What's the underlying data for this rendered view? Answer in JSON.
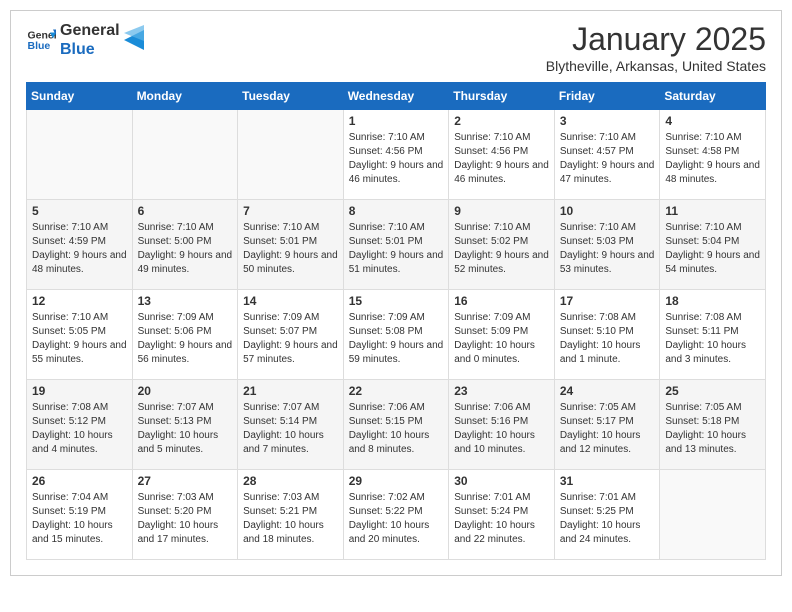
{
  "header": {
    "logo_line1": "General",
    "logo_line2": "Blue",
    "month": "January 2025",
    "location": "Blytheville, Arkansas, United States"
  },
  "days_of_week": [
    "Sunday",
    "Monday",
    "Tuesday",
    "Wednesday",
    "Thursday",
    "Friday",
    "Saturday"
  ],
  "weeks": [
    [
      {
        "day": "",
        "info": ""
      },
      {
        "day": "",
        "info": ""
      },
      {
        "day": "",
        "info": ""
      },
      {
        "day": "1",
        "info": "Sunrise: 7:10 AM\nSunset: 4:56 PM\nDaylight: 9 hours and 46 minutes."
      },
      {
        "day": "2",
        "info": "Sunrise: 7:10 AM\nSunset: 4:56 PM\nDaylight: 9 hours and 46 minutes."
      },
      {
        "day": "3",
        "info": "Sunrise: 7:10 AM\nSunset: 4:57 PM\nDaylight: 9 hours and 47 minutes."
      },
      {
        "day": "4",
        "info": "Sunrise: 7:10 AM\nSunset: 4:58 PM\nDaylight: 9 hours and 48 minutes."
      }
    ],
    [
      {
        "day": "5",
        "info": "Sunrise: 7:10 AM\nSunset: 4:59 PM\nDaylight: 9 hours and 48 minutes."
      },
      {
        "day": "6",
        "info": "Sunrise: 7:10 AM\nSunset: 5:00 PM\nDaylight: 9 hours and 49 minutes."
      },
      {
        "day": "7",
        "info": "Sunrise: 7:10 AM\nSunset: 5:01 PM\nDaylight: 9 hours and 50 minutes."
      },
      {
        "day": "8",
        "info": "Sunrise: 7:10 AM\nSunset: 5:01 PM\nDaylight: 9 hours and 51 minutes."
      },
      {
        "day": "9",
        "info": "Sunrise: 7:10 AM\nSunset: 5:02 PM\nDaylight: 9 hours and 52 minutes."
      },
      {
        "day": "10",
        "info": "Sunrise: 7:10 AM\nSunset: 5:03 PM\nDaylight: 9 hours and 53 minutes."
      },
      {
        "day": "11",
        "info": "Sunrise: 7:10 AM\nSunset: 5:04 PM\nDaylight: 9 hours and 54 minutes."
      }
    ],
    [
      {
        "day": "12",
        "info": "Sunrise: 7:10 AM\nSunset: 5:05 PM\nDaylight: 9 hours and 55 minutes."
      },
      {
        "day": "13",
        "info": "Sunrise: 7:09 AM\nSunset: 5:06 PM\nDaylight: 9 hours and 56 minutes."
      },
      {
        "day": "14",
        "info": "Sunrise: 7:09 AM\nSunset: 5:07 PM\nDaylight: 9 hours and 57 minutes."
      },
      {
        "day": "15",
        "info": "Sunrise: 7:09 AM\nSunset: 5:08 PM\nDaylight: 9 hours and 59 minutes."
      },
      {
        "day": "16",
        "info": "Sunrise: 7:09 AM\nSunset: 5:09 PM\nDaylight: 10 hours and 0 minutes."
      },
      {
        "day": "17",
        "info": "Sunrise: 7:08 AM\nSunset: 5:10 PM\nDaylight: 10 hours and 1 minute."
      },
      {
        "day": "18",
        "info": "Sunrise: 7:08 AM\nSunset: 5:11 PM\nDaylight: 10 hours and 3 minutes."
      }
    ],
    [
      {
        "day": "19",
        "info": "Sunrise: 7:08 AM\nSunset: 5:12 PM\nDaylight: 10 hours and 4 minutes."
      },
      {
        "day": "20",
        "info": "Sunrise: 7:07 AM\nSunset: 5:13 PM\nDaylight: 10 hours and 5 minutes."
      },
      {
        "day": "21",
        "info": "Sunrise: 7:07 AM\nSunset: 5:14 PM\nDaylight: 10 hours and 7 minutes."
      },
      {
        "day": "22",
        "info": "Sunrise: 7:06 AM\nSunset: 5:15 PM\nDaylight: 10 hours and 8 minutes."
      },
      {
        "day": "23",
        "info": "Sunrise: 7:06 AM\nSunset: 5:16 PM\nDaylight: 10 hours and 10 minutes."
      },
      {
        "day": "24",
        "info": "Sunrise: 7:05 AM\nSunset: 5:17 PM\nDaylight: 10 hours and 12 minutes."
      },
      {
        "day": "25",
        "info": "Sunrise: 7:05 AM\nSunset: 5:18 PM\nDaylight: 10 hours and 13 minutes."
      }
    ],
    [
      {
        "day": "26",
        "info": "Sunrise: 7:04 AM\nSunset: 5:19 PM\nDaylight: 10 hours and 15 minutes."
      },
      {
        "day": "27",
        "info": "Sunrise: 7:03 AM\nSunset: 5:20 PM\nDaylight: 10 hours and 17 minutes."
      },
      {
        "day": "28",
        "info": "Sunrise: 7:03 AM\nSunset: 5:21 PM\nDaylight: 10 hours and 18 minutes."
      },
      {
        "day": "29",
        "info": "Sunrise: 7:02 AM\nSunset: 5:22 PM\nDaylight: 10 hours and 20 minutes."
      },
      {
        "day": "30",
        "info": "Sunrise: 7:01 AM\nSunset: 5:24 PM\nDaylight: 10 hours and 22 minutes."
      },
      {
        "day": "31",
        "info": "Sunrise: 7:01 AM\nSunset: 5:25 PM\nDaylight: 10 hours and 24 minutes."
      },
      {
        "day": "",
        "info": ""
      }
    ]
  ]
}
